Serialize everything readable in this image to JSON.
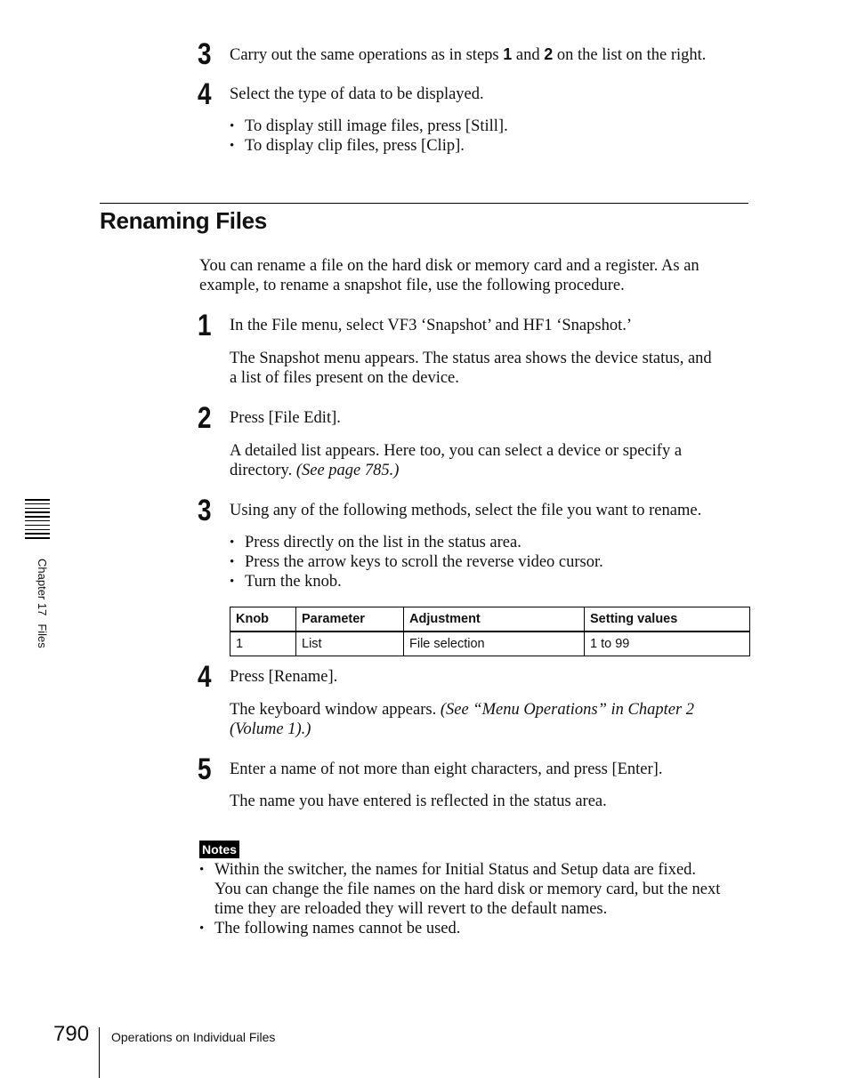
{
  "top_section": {
    "step3": {
      "number": "3",
      "text_before": "Carry out the same operations as in steps ",
      "bold1": "1",
      "text_mid": " and ",
      "bold2": "2",
      "text_after": " on the list on the right."
    },
    "step4": {
      "number": "4",
      "text": "Select the type of data to be displayed.",
      "bullets": [
        "To display still image files, press [Still].",
        "To display clip files, press [Clip]."
      ]
    }
  },
  "section": {
    "heading": "Renaming Files",
    "intro_line1": "You can rename a file on the hard disk or memory card and a register. As an",
    "intro_line2": "example, to rename a snapshot file, use the following procedure."
  },
  "steps": [
    {
      "number": "1",
      "text": "In the File menu, select VF3 ‘Snapshot’ and HF1 ‘Snapshot.’",
      "detail_line1": "The Snapshot menu appears. The status area shows the device status, and",
      "detail_line2": "a list of files present on the device."
    },
    {
      "number": "2",
      "text": "Press [File Edit].",
      "detail_line1": "A detailed list appears. Here too, you can select a device or specify a",
      "detail_line2": "directory. ",
      "detail_ref": "(See page 785.)"
    },
    {
      "number": "3",
      "text": "Using any of the following methods, select the file you want to rename.",
      "bullets": [
        "Press directly on the list in the status area.",
        "Press the arrow keys to scroll the reverse video cursor.",
        "Turn the knob."
      ]
    },
    {
      "number": "4",
      "text": "Press [Rename].",
      "detail_line1": "The keyboard window appears. ",
      "detail_ref_line1": "(See “Menu Operations” in Chapter 2",
      "detail_ref_line2": "(Volume 1).)"
    },
    {
      "number": "5",
      "text": "Enter a name of not more than eight characters, and press [Enter].",
      "detail_line1": "The name you have entered is reflected in the status area."
    }
  ],
  "knob_table": {
    "headers": [
      "Knob",
      "Parameter",
      "Adjustment",
      "Setting values"
    ],
    "rows": [
      [
        "1",
        "List",
        "File selection",
        "1 to 99"
      ]
    ]
  },
  "notes": {
    "badge": "Notes",
    "items": [
      {
        "line1": "Within the switcher, the names for Initial Status and Setup data are fixed.",
        "line2": "You can change the file names on the hard disk or memory card, but the next",
        "line3": "time they are reloaded they will revert to the default names."
      },
      {
        "line1": "The following names cannot be used."
      }
    ]
  },
  "sidebar": {
    "chapter": "Chapter 17",
    "title": "Files"
  },
  "footer": {
    "page_number": "790",
    "section_title": "Operations on Individual Files"
  }
}
